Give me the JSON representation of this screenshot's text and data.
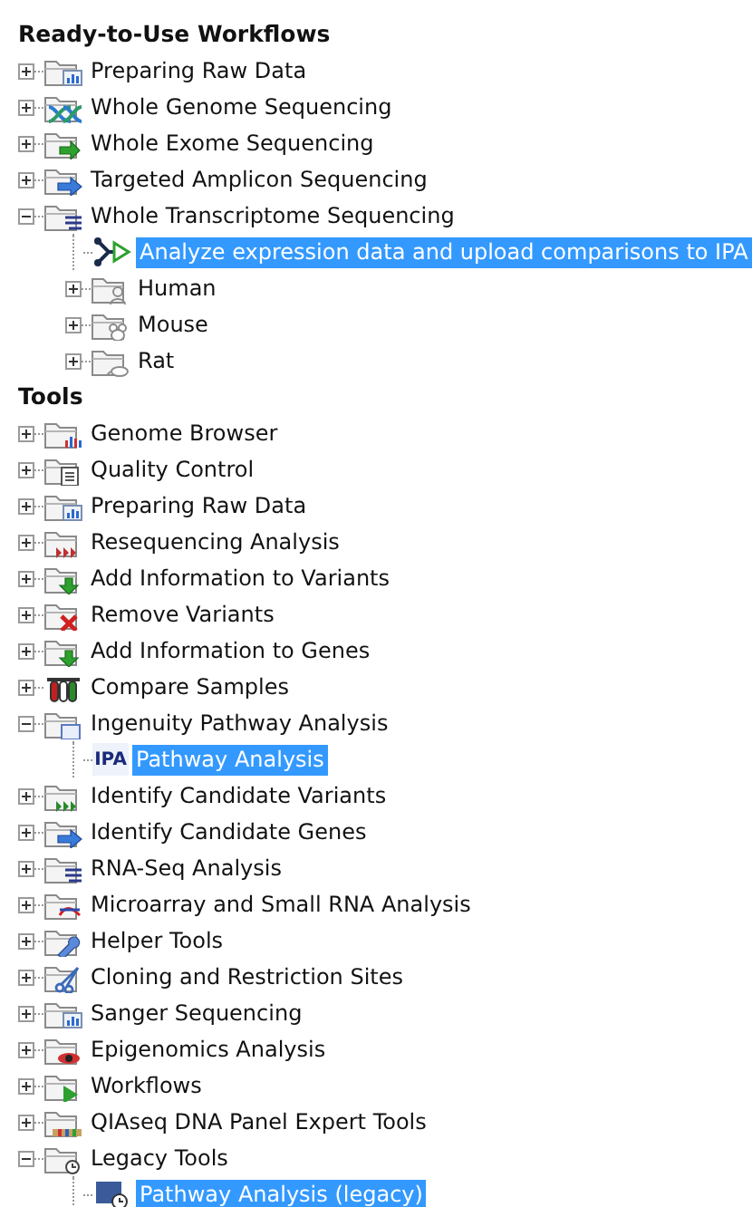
{
  "sections": [
    {
      "title": "Ready-to-Use Workflows",
      "items": [
        {
          "label": "Preparing Raw Data",
          "kind": "folder",
          "expanded": false,
          "selected": false
        },
        {
          "label": "Whole Genome Sequencing",
          "kind": "folder",
          "expanded": false,
          "selected": false
        },
        {
          "label": "Whole Exome Sequencing",
          "kind": "folder",
          "expanded": false,
          "selected": false
        },
        {
          "label": "Targeted Amplicon Sequencing",
          "kind": "folder",
          "expanded": false,
          "selected": false
        },
        {
          "label": "Whole Transcriptome Sequencing",
          "kind": "folder",
          "expanded": true,
          "selected": false,
          "children": [
            {
              "label": "Analyze expression data and upload comparisons to IPA",
              "kind": "workflow",
              "selected": true
            },
            {
              "label": "Human",
              "kind": "folder",
              "expanded": false,
              "selected": false
            },
            {
              "label": "Mouse",
              "kind": "folder",
              "expanded": false,
              "selected": false
            },
            {
              "label": "Rat",
              "kind": "folder",
              "expanded": false,
              "selected": false
            }
          ]
        }
      ]
    },
    {
      "title": "Tools",
      "items": [
        {
          "label": "Genome Browser",
          "kind": "folder",
          "expanded": false,
          "selected": false
        },
        {
          "label": "Quality Control",
          "kind": "folder",
          "expanded": false,
          "selected": false
        },
        {
          "label": "Preparing Raw Data",
          "kind": "folder",
          "expanded": false,
          "selected": false
        },
        {
          "label": "Resequencing Analysis",
          "kind": "folder",
          "expanded": false,
          "selected": false
        },
        {
          "label": "Add Information to Variants",
          "kind": "folder",
          "expanded": false,
          "selected": false
        },
        {
          "label": "Remove Variants",
          "kind": "folder",
          "expanded": false,
          "selected": false
        },
        {
          "label": "Add Information to Genes",
          "kind": "folder",
          "expanded": false,
          "selected": false
        },
        {
          "label": "Compare Samples",
          "kind": "folder",
          "expanded": false,
          "selected": false
        },
        {
          "label": "Ingenuity Pathway Analysis",
          "kind": "folder",
          "expanded": true,
          "selected": false,
          "children": [
            {
              "label": "Pathway Analysis",
              "kind": "tool",
              "icon_text": "IPA",
              "selected": true
            }
          ]
        },
        {
          "label": "Identify Candidate Variants",
          "kind": "folder",
          "expanded": false,
          "selected": false
        },
        {
          "label": "Identify Candidate Genes",
          "kind": "folder",
          "expanded": false,
          "selected": false
        },
        {
          "label": "RNA-Seq Analysis",
          "kind": "folder",
          "expanded": false,
          "selected": false
        },
        {
          "label": "Microarray and Small RNA Analysis",
          "kind": "folder",
          "expanded": false,
          "selected": false
        },
        {
          "label": "Helper Tools",
          "kind": "folder",
          "expanded": false,
          "selected": false
        },
        {
          "label": "Cloning and Restriction Sites",
          "kind": "folder",
          "expanded": false,
          "selected": false
        },
        {
          "label": "Sanger Sequencing",
          "kind": "folder",
          "expanded": false,
          "selected": false
        },
        {
          "label": "Epigenomics Analysis",
          "kind": "folder",
          "expanded": false,
          "selected": false
        },
        {
          "label": "Workflows",
          "kind": "folder",
          "expanded": false,
          "selected": false
        },
        {
          "label": "QIAseq DNA Panel Expert Tools",
          "kind": "folder",
          "expanded": false,
          "selected": false
        },
        {
          "label": "Legacy Tools",
          "kind": "folder",
          "expanded": true,
          "selected": false,
          "children": [
            {
              "label": "Pathway Analysis (legacy)",
              "kind": "legacy-tool",
              "selected": true
            }
          ]
        }
      ]
    }
  ]
}
